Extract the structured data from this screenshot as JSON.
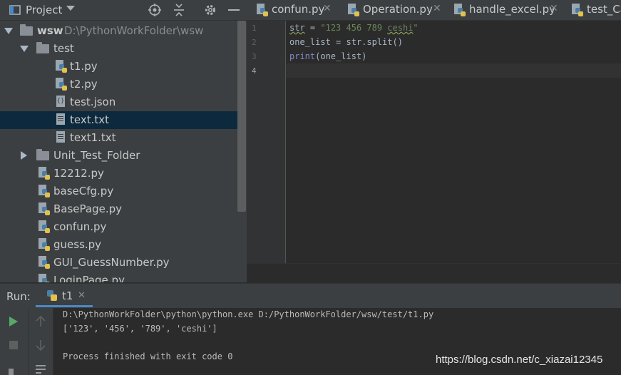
{
  "project_panel": {
    "title": "Project",
    "tree": [
      {
        "name": "wsw",
        "path": "D:\\PythonWorkFolder\\wsw",
        "kind": "root-folder",
        "expanded": true
      },
      {
        "name": "test",
        "kind": "folder",
        "expanded": true
      },
      {
        "name": "t1.py",
        "kind": "python-file"
      },
      {
        "name": "t2.py",
        "kind": "python-file"
      },
      {
        "name": "test.json",
        "kind": "json-file"
      },
      {
        "name": "text.txt",
        "kind": "text-file",
        "selected": true
      },
      {
        "name": "text1.txt",
        "kind": "text-file"
      },
      {
        "name": "Unit_Test_Folder",
        "kind": "folder",
        "expanded": false
      },
      {
        "name": "12212.py",
        "kind": "python-file"
      },
      {
        "name": "baseCfg.py",
        "kind": "python-file"
      },
      {
        "name": "BasePage.py",
        "kind": "python-file"
      },
      {
        "name": "confun.py",
        "kind": "python-file"
      },
      {
        "name": "guess.py",
        "kind": "python-file"
      },
      {
        "name": "GUI_GuessNumber.py",
        "kind": "python-file"
      },
      {
        "name": "LoginPage.py",
        "kind": "python-file"
      }
    ]
  },
  "editor": {
    "tabs": [
      {
        "label": "confun.py"
      },
      {
        "label": "Operation.py"
      },
      {
        "label": "handle_excel.py"
      },
      {
        "label": "test_Ca"
      }
    ],
    "line_numbers": [
      "1",
      "2",
      "3",
      "4"
    ],
    "code": {
      "line1_var": "str",
      "line1_eq": " = ",
      "line1_str_a": "\"123 456 789 ",
      "line1_str_b": "ceshi",
      "line1_str_c": "\"",
      "line2": "one_list = str.split()",
      "line3_fn": "print",
      "line3_rest": "(one_list)"
    }
  },
  "run_panel": {
    "label": "Run:",
    "tab": "t1",
    "output": [
      "D:\\PythonWorkFolder\\python\\python.exe D:/PythonWorkFolder/wsw/test/t1.py",
      "['123', '456', '789', 'ceshi']",
      "",
      "Process finished with exit code 0"
    ]
  },
  "watermark": "https://blog.csdn.net/c_xiazai12345",
  "colors": {
    "panel_bg": "#3c3f41",
    "editor_bg": "#2b2b2b",
    "selection": "#0d293e",
    "string": "#6a8759",
    "builtin": "#8888c6",
    "run_green": "#59a869"
  }
}
